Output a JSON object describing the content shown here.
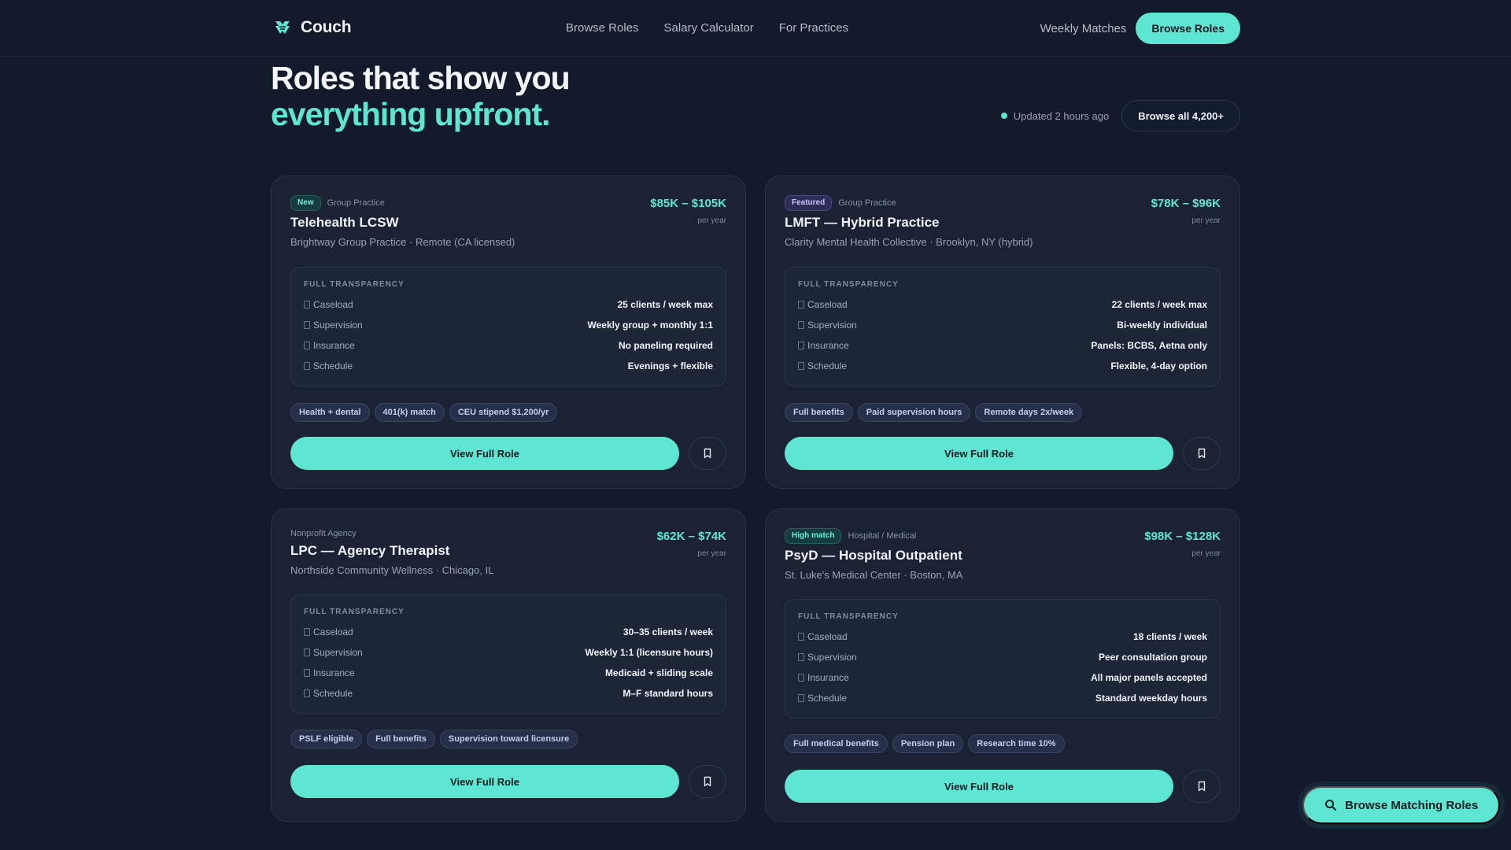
{
  "nav": {
    "brand": "Couch",
    "links": [
      "Browse Roles",
      "Salary Calculator",
      "For Practices"
    ],
    "weekly": "Weekly Matches",
    "cta": "Browse Roles"
  },
  "hero": {
    "line1": "Roles that show you",
    "line2": "everything upfront.",
    "updated": "Updated 2 hours ago",
    "browse_all": "Browse all 4,200+"
  },
  "transparency_title": "FULL TRANSPARENCY",
  "view_label": "View Full Role",
  "cards": [
    {
      "badge": "New",
      "category": "Group Practice",
      "title": "Telehealth LCSW",
      "subtitle": "Brightway Group Practice · Remote (CA licensed)",
      "salary": "$85K – $105K",
      "period": "per year",
      "rows": [
        {
          "label": "Caseload",
          "value": "25 clients / week max"
        },
        {
          "label": "Supervision",
          "value": "Weekly group + monthly 1:1"
        },
        {
          "label": "Insurance",
          "value": "No paneling required"
        },
        {
          "label": "Schedule",
          "value": "Evenings + flexible"
        }
      ],
      "tags": [
        "Health + dental",
        "401(k) match",
        "CEU stipend $1,200/yr"
      ]
    },
    {
      "badge": "Featured",
      "category": "Group Practice",
      "title": "LMFT — Hybrid Practice",
      "subtitle": "Clarity Mental Health Collective · Brooklyn, NY (hybrid)",
      "salary": "$78K – $96K",
      "period": "per year",
      "rows": [
        {
          "label": "Caseload",
          "value": "22 clients / week max"
        },
        {
          "label": "Supervision",
          "value": "Bi-weekly individual"
        },
        {
          "label": "Insurance",
          "value": "Panels: BCBS, Aetna only"
        },
        {
          "label": "Schedule",
          "value": "Flexible, 4-day option"
        }
      ],
      "tags": [
        "Full benefits",
        "Paid supervision hours",
        "Remote days 2x/week"
      ]
    },
    {
      "badge": "",
      "category": "Nonprofit Agency",
      "title": "LPC — Agency Therapist",
      "subtitle": "Northside Community Wellness · Chicago, IL",
      "salary": "$62K – $74K",
      "period": "per year",
      "rows": [
        {
          "label": "Caseload",
          "value": "30–35 clients / week"
        },
        {
          "label": "Supervision",
          "value": "Weekly 1:1 (licensure hours)"
        },
        {
          "label": "Insurance",
          "value": "Medicaid + sliding scale"
        },
        {
          "label": "Schedule",
          "value": "M–F standard hours"
        }
      ],
      "tags": [
        "PSLF eligible",
        "Full benefits",
        "Supervision toward licensure"
      ]
    },
    {
      "badge": "High match",
      "category": "Hospital / Medical",
      "title": "PsyD — Hospital Outpatient",
      "subtitle": "St. Luke's Medical Center · Boston, MA",
      "salary": "$98K – $128K",
      "period": "per year",
      "rows": [
        {
          "label": "Caseload",
          "value": "18 clients / week"
        },
        {
          "label": "Supervision",
          "value": "Peer consultation group"
        },
        {
          "label": "Insurance",
          "value": "All major panels accepted"
        },
        {
          "label": "Schedule",
          "value": "Standard weekday hours"
        }
      ],
      "tags": [
        "Full medical benefits",
        "Pension plan",
        "Research time 10%"
      ]
    }
  ],
  "float_button": "Browse Matching Roles",
  "colors": {
    "background": "#121a2b",
    "card": "#1a2234",
    "accent": "#5ee6d2",
    "tag": "#27304a"
  },
  "icons": [
    "logo-icon",
    "bookmark-icon",
    "search-icon",
    "document-icon"
  ]
}
